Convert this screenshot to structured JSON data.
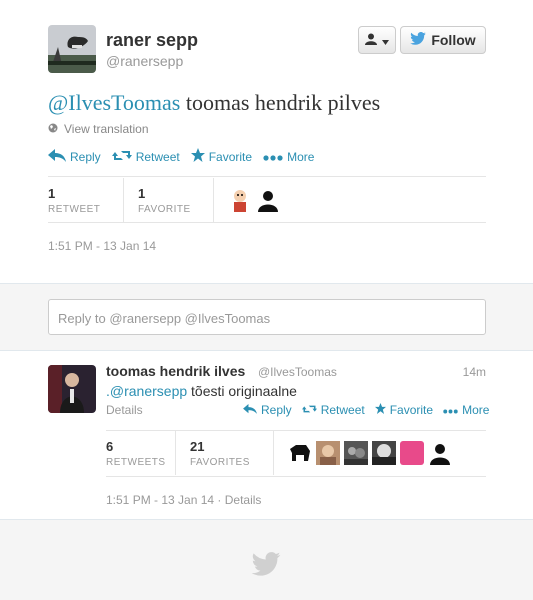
{
  "tweet": {
    "user_name": "raner sepp",
    "user_handle": "@ranersepp",
    "text_mention": "@IlvesToomas",
    "text_body": " toomas hendrik pilves",
    "view_translation": "View translation",
    "actions": {
      "reply": "Reply",
      "retweet": "Retweet",
      "favorite": "Favorite",
      "more": "More"
    },
    "stats": {
      "retweets": "1",
      "retweets_label": "RETWEET",
      "favorites": "1",
      "favorites_label": "FAVORITE"
    },
    "timestamp": "1:51 PM - 13 Jan 14",
    "follow_label": "Follow"
  },
  "reply_box": {
    "placeholder_prefix": "Reply to ",
    "mentions": "@ranersepp @IlvesToomas"
  },
  "reply_tweet": {
    "user_name": "toomas hendrik ilves",
    "user_handle": "@IlvesToomas",
    "time": "14m",
    "text_mention": ".@ranersepp",
    "text_body": " tõesti originaalne",
    "details": "Details",
    "actions": {
      "reply": "Reply",
      "retweet": "Retweet",
      "favorite": "Favorite",
      "more": "More"
    },
    "stats": {
      "retweets": "6",
      "retweets_label": "RETWEETS",
      "favorites": "21",
      "favorites_label": "FAVORITES"
    },
    "timestamp": "1:51 PM - 13 Jan 14 · Details"
  },
  "colors": {
    "link": "#2b8fb2",
    "twitter_blue": "#4aa3df",
    "muted": "#999999"
  },
  "icons": [
    "user-icon",
    "twitter-bird-icon",
    "globe-icon",
    "reply-icon",
    "retweet-icon",
    "star-icon",
    "more-icon"
  ]
}
